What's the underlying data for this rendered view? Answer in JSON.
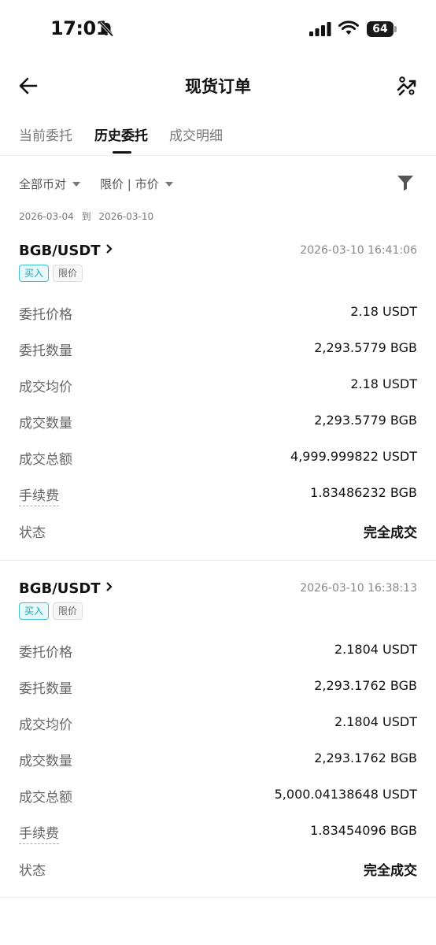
{
  "status_bar": {
    "time": "17:01",
    "battery": "64"
  },
  "header": {
    "title": "现货订单"
  },
  "tabs": [
    {
      "label": "当前委托"
    },
    {
      "label": "历史委托"
    },
    {
      "label": "成交明细"
    }
  ],
  "filters": {
    "pair_dropdown": "全部币对",
    "type_dropdown": "限价 | 市价"
  },
  "date_range": {
    "from": "2026-03-04",
    "sep": "到",
    "to": "2026-03-10"
  },
  "orders": [
    {
      "pair": "BGB/USDT",
      "time": "2026-03-10 16:41:06",
      "side": "买入",
      "type": "限价",
      "fields": [
        {
          "label": "委托价格",
          "value": "2.18 USDT"
        },
        {
          "label": "委托数量",
          "value": "2,293.5779 BGB"
        },
        {
          "label": "成交均价",
          "value": "2.18 USDT"
        },
        {
          "label": "成交数量",
          "value": "2,293.5779 BGB"
        },
        {
          "label": "成交总额",
          "value": "4,999.999822 USDT"
        },
        {
          "label": "手续费",
          "value": "1.83486232 BGB"
        },
        {
          "label": "状态",
          "value": "完全成交"
        }
      ]
    },
    {
      "pair": "BGB/USDT",
      "time": "2026-03-10 16:38:13",
      "side": "买入",
      "type": "限价",
      "fields": [
        {
          "label": "委托价格",
          "value": "2.1804 USDT"
        },
        {
          "label": "委托数量",
          "value": "2,293.1762 BGB"
        },
        {
          "label": "成交均价",
          "value": "2.1804 USDT"
        },
        {
          "label": "成交数量",
          "value": "2,293.1762 BGB"
        },
        {
          "label": "成交总额",
          "value": "5,000.04138648 USDT"
        },
        {
          "label": "手续费",
          "value": "1.83454096 BGB"
        },
        {
          "label": "状态",
          "value": "完全成交"
        }
      ]
    }
  ]
}
